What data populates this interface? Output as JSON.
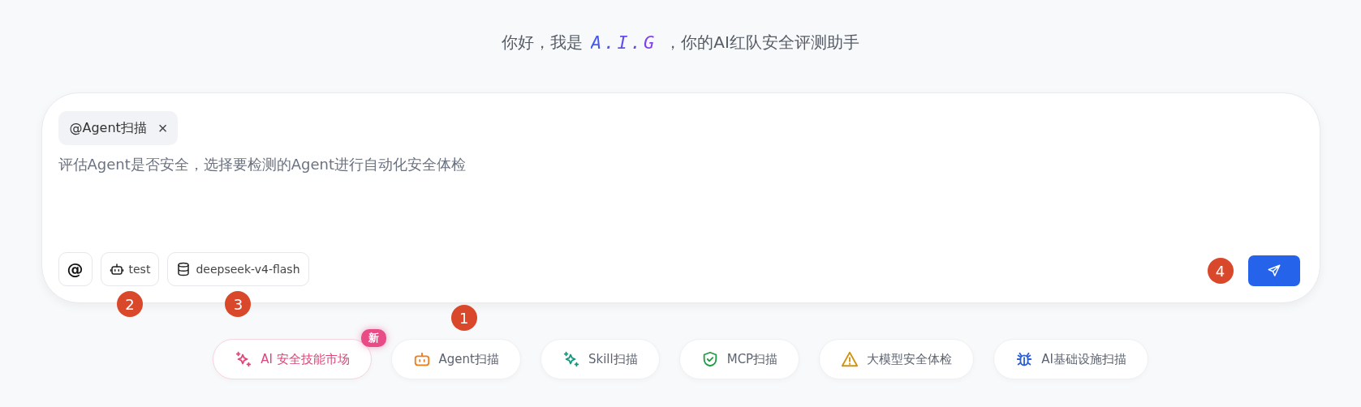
{
  "greeting": {
    "before": "你好，我是",
    "brand": "A.I.G",
    "after": "，你的AI红队安全评测助手"
  },
  "composer": {
    "tag": {
      "label": "@Agent扫描",
      "close": "×"
    },
    "text": "评估Agent是否安全，选择要检测的Agent进行自动化安全体检",
    "tools": [
      {
        "kind": "mention",
        "label": "@"
      },
      {
        "kind": "agent",
        "label": "test",
        "marker": "2"
      },
      {
        "kind": "model",
        "label": "deepseek-v4-flash",
        "marker": "3"
      }
    ],
    "send": {
      "marker": "4"
    }
  },
  "shortcuts": [
    {
      "kind": "sparkle",
      "label": "AI 安全技能市场",
      "color": "#e0457b",
      "featured": true,
      "badge": "新"
    },
    {
      "kind": "robot",
      "label": "Agent扫描",
      "color": "#f07c1a",
      "featured": false,
      "marker": "1"
    },
    {
      "kind": "sparkle",
      "label": "Skill扫描",
      "color": "#14967f",
      "featured": false
    },
    {
      "kind": "shield",
      "label": "MCP扫描",
      "color": "#1f9d45",
      "featured": false
    },
    {
      "kind": "warning",
      "label": "大模型安全体检",
      "color": "#cf9312",
      "featured": false
    },
    {
      "kind": "bug",
      "label": "AI基础设施扫描",
      "color": "#2b5fd9",
      "featured": false
    }
  ]
}
